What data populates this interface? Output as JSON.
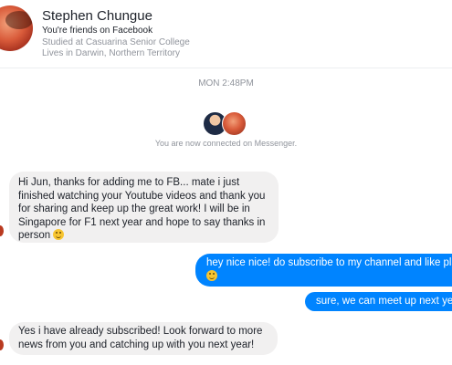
{
  "header": {
    "name": "Stephen Chungue",
    "friends_text": "You're friends on Facebook",
    "studied": "Studied at Casuarina Senior College",
    "lives": "Lives in Darwin, Northern Territory"
  },
  "conversation": {
    "timestamp": "MON 2:48PM",
    "connected_text": "You are now connected on Messenger."
  },
  "messages": [
    {
      "direction": "incoming",
      "text": "Hi Jun, thanks for adding me to FB... mate i just finished watching your Youtube videos and thank you for sharing and keep up the great work! I will be in Singapore for F1 next year and hope to say thanks in person",
      "emoji": "smile-emoji"
    },
    {
      "direction": "outgoing",
      "text": "hey nice nice! do subscribe to my channel and like pls",
      "emoji": "grin-emoji"
    },
    {
      "direction": "outgoing",
      "text": "sure, we can meet up next year"
    },
    {
      "direction": "incoming",
      "text": "Yes i have already subscribed! Look forward to more news from you and catching up with you next year!"
    }
  ],
  "colors": {
    "outgoing_bubble": "#0084ff",
    "incoming_bubble": "#f1f0f0",
    "muted_text": "#90949c"
  }
}
